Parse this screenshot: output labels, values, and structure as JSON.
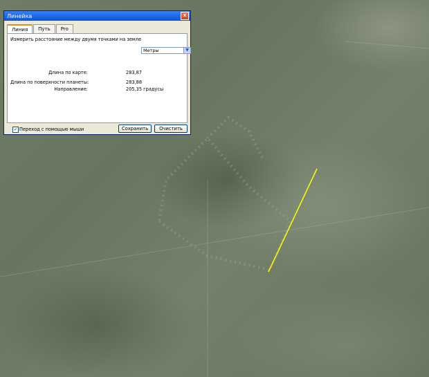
{
  "window": {
    "title": "Линейка",
    "close_label": "x"
  },
  "tabs": [
    {
      "label": "Линия",
      "active": true
    },
    {
      "label": "Путь",
      "active": false
    },
    {
      "label": "Pro",
      "active": false
    }
  ],
  "line_tab": {
    "description": "Измерить расстояние между двумя точками на земле",
    "map_length_label": "Длина по карте:",
    "map_length_value": "283,87",
    "unit_selected": "Метры",
    "surface_length_label": "Длина по поверхности планеты:",
    "surface_length_value": "283,88",
    "heading_label": "Направление:",
    "heading_value": "205,35 градусы"
  },
  "footer": {
    "mouse_nav_label": "Переход с помощью мыши",
    "mouse_nav_checked": true,
    "save_label": "Сохранить",
    "clear_label": "Очистить"
  },
  "map": {
    "measure_line_color": "#ffff00"
  }
}
